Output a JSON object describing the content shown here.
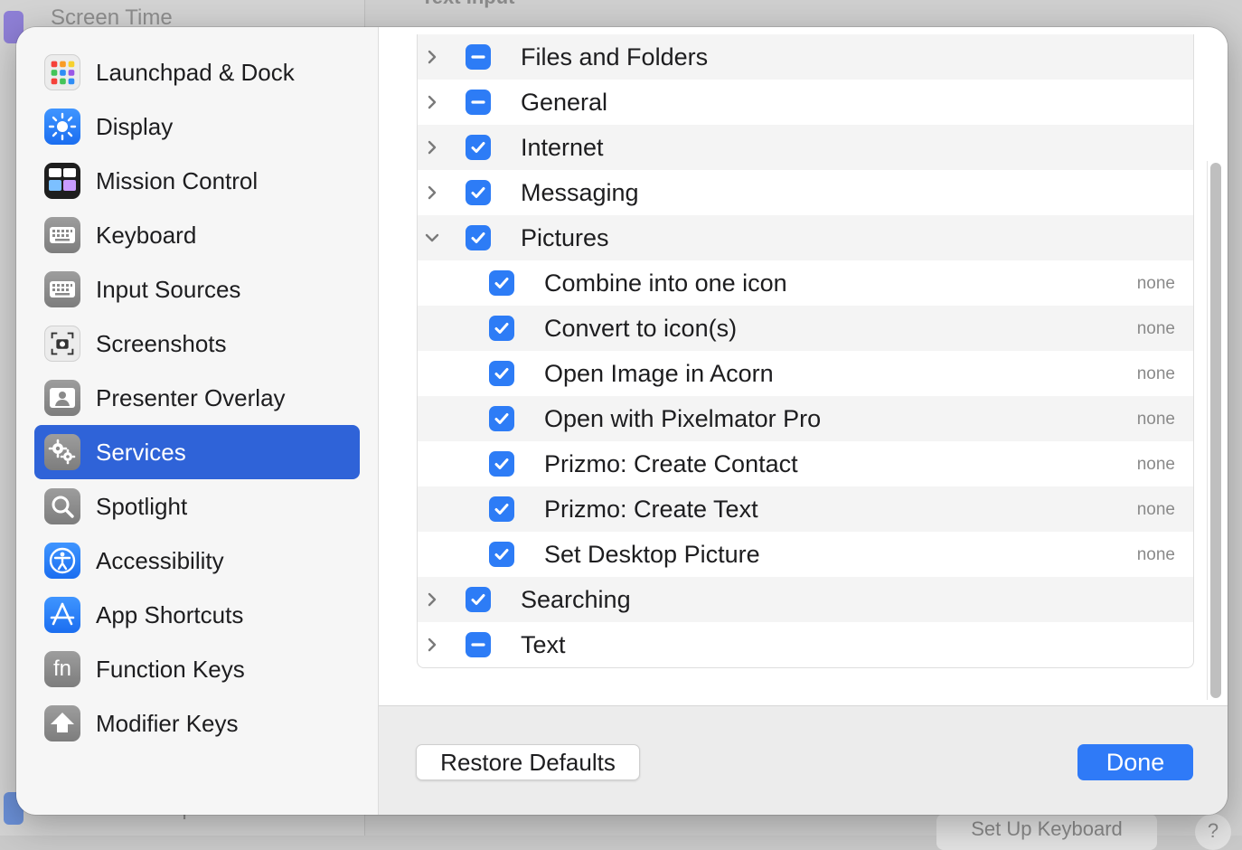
{
  "background": {
    "sidebar_top_item": "Screen Time",
    "sidebar_bottom_item": "Users & Groups",
    "section_heading": "Text Input",
    "setup_keyboard_button": "Set Up Keyboard",
    "help_button": "?"
  },
  "sidebar": {
    "items": [
      {
        "label": "Launchpad & Dock",
        "icon": "launchpad-dock-icon"
      },
      {
        "label": "Display",
        "icon": "display-icon"
      },
      {
        "label": "Mission Control",
        "icon": "mission-control-icon"
      },
      {
        "label": "Keyboard",
        "icon": "keyboard-icon"
      },
      {
        "label": "Input Sources",
        "icon": "input-sources-icon"
      },
      {
        "label": "Screenshots",
        "icon": "screenshots-icon"
      },
      {
        "label": "Presenter Overlay",
        "icon": "presenter-overlay-icon"
      },
      {
        "label": "Services",
        "icon": "services-icon",
        "selected": true
      },
      {
        "label": "Spotlight",
        "icon": "spotlight-icon"
      },
      {
        "label": "Accessibility",
        "icon": "accessibility-icon"
      },
      {
        "label": "App Shortcuts",
        "icon": "app-shortcuts-icon"
      },
      {
        "label": "Function Keys",
        "icon": "function-keys-icon",
        "glyph": "fn"
      },
      {
        "label": "Modifier Keys",
        "icon": "modifier-keys-icon"
      }
    ]
  },
  "services": {
    "rows": [
      {
        "label": "Files and Folders",
        "state": "mixed",
        "expanded": false
      },
      {
        "label": "General",
        "state": "mixed",
        "expanded": false
      },
      {
        "label": "Internet",
        "state": "checked",
        "expanded": false
      },
      {
        "label": "Messaging",
        "state": "checked",
        "expanded": false
      },
      {
        "label": "Pictures",
        "state": "checked",
        "expanded": true
      },
      {
        "label": "Combine into one icon",
        "state": "checked",
        "child": true,
        "shortcut": "none"
      },
      {
        "label": "Convert to icon(s)",
        "state": "checked",
        "child": true,
        "shortcut": "none"
      },
      {
        "label": "Open Image in Acorn",
        "state": "checked",
        "child": true,
        "shortcut": "none"
      },
      {
        "label": "Open with Pixelmator Pro",
        "state": "checked",
        "child": true,
        "shortcut": "none"
      },
      {
        "label": "Prizmo: Create Contact",
        "state": "checked",
        "child": true,
        "shortcut": "none"
      },
      {
        "label": "Prizmo: Create Text",
        "state": "checked",
        "child": true,
        "shortcut": "none"
      },
      {
        "label": "Set Desktop Picture",
        "state": "checked",
        "child": true,
        "shortcut": "none"
      },
      {
        "label": "Searching",
        "state": "checked",
        "expanded": false
      },
      {
        "label": "Text",
        "state": "mixed",
        "expanded": false
      }
    ]
  },
  "footer": {
    "restore_label": "Restore Defaults",
    "done_label": "Done"
  },
  "colors": {
    "accent": "#2f7af7",
    "selection": "#2f63d8",
    "checkbox": "#2d7cf6"
  }
}
